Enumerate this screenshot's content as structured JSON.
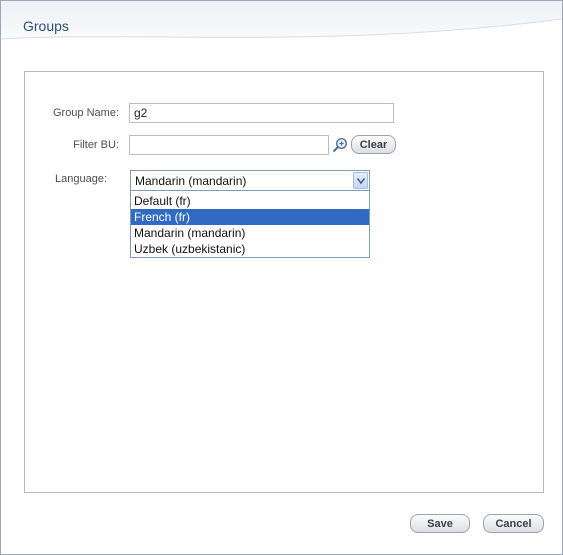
{
  "window": {
    "title": "Groups"
  },
  "form": {
    "group_name_label": "Group Name:",
    "group_name_value": "g2",
    "filter_bu_label": "Filter BU:",
    "filter_bu_value": "",
    "clear_label": "Clear",
    "language_label": "Language:",
    "language_selected": "Mandarin (mandarin)",
    "language_options": [
      {
        "label": "Default (fr)",
        "highlighted": false
      },
      {
        "label": "French (fr)",
        "highlighted": true
      },
      {
        "label": "Mandarin (mandarin)",
        "highlighted": false
      },
      {
        "label": "Uzbek (uzbekistanic)",
        "highlighted": false
      }
    ]
  },
  "footer": {
    "save_label": "Save",
    "cancel_label": "Cancel"
  },
  "colors": {
    "title": "#2e4f7c",
    "highlight": "#316ac5",
    "border": "#7f9db9"
  },
  "icons": {
    "search": "magnifier-plus-icon",
    "dropdown": "chevron-down-icon"
  }
}
